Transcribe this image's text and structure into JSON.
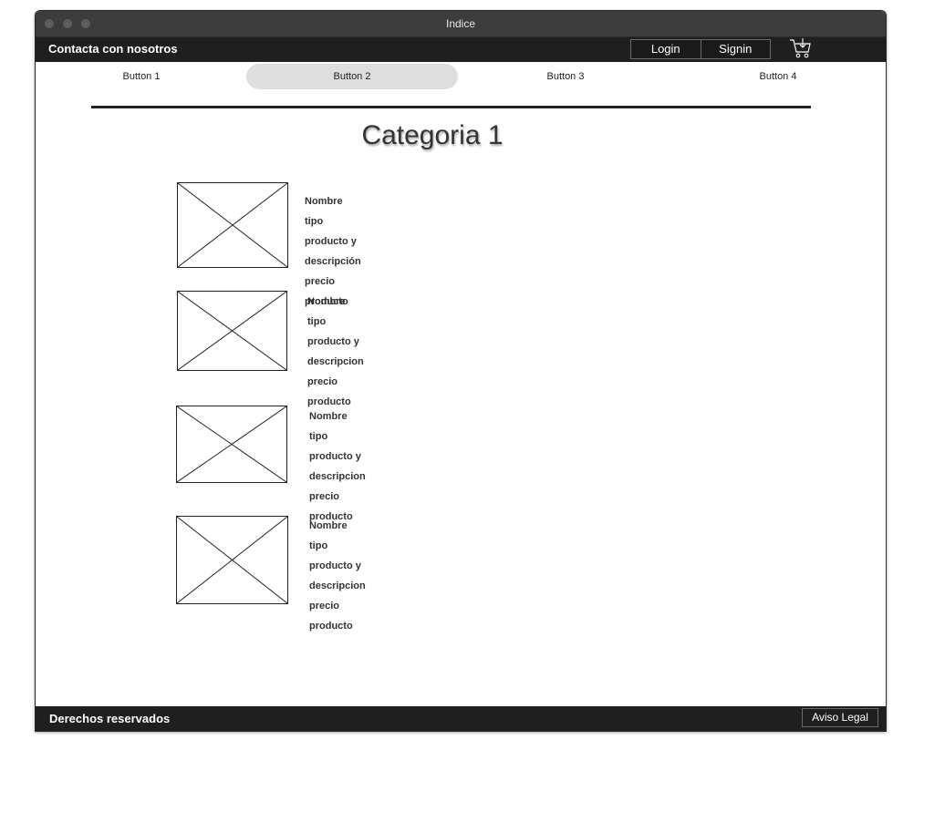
{
  "window": {
    "title": "Indice"
  },
  "header": {
    "contact_label": "Contacta con nosotros",
    "login_label": "Login",
    "signin_label": "Signin",
    "cart_icon": "shopping-cart-icon"
  },
  "nav": {
    "buttons": [
      {
        "label": "Button 1",
        "active": false
      },
      {
        "label": "Button 2",
        "active": true
      },
      {
        "label": "Button 3",
        "active": false
      },
      {
        "label": "Button 4",
        "active": false
      }
    ]
  },
  "main": {
    "title": "Categoria 1",
    "products": [
      {
        "name": "Nombre",
        "description": "tipo producto y descripción",
        "price": "precio producto"
      },
      {
        "name": "Nombre",
        "description": "tipo producto y  descripcion",
        "price": "precio producto"
      },
      {
        "name": "Nombre",
        "description": "tipo producto y  descripcion",
        "price": "precio producto"
      },
      {
        "name": "Nombre",
        "description": "tipo producto y  descripcion",
        "price": "precio producto"
      }
    ]
  },
  "footer": {
    "rights_label": "Derechos reservados",
    "legal_label": "Aviso Legal"
  }
}
